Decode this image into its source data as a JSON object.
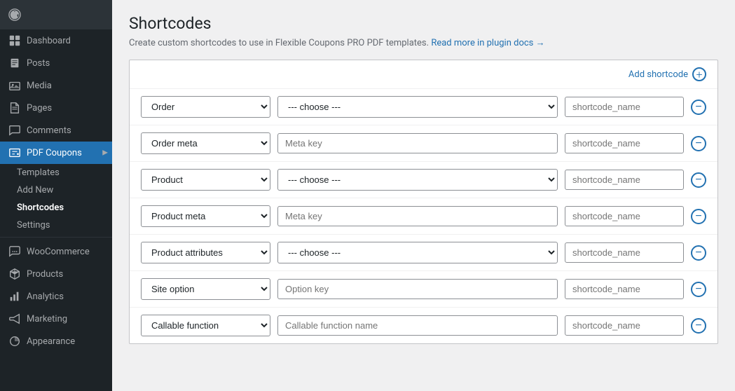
{
  "sidebar": {
    "logo_icon": "wp-logo",
    "items": [
      {
        "id": "dashboard",
        "label": "Dashboard",
        "icon": "dashboard"
      },
      {
        "id": "posts",
        "label": "Posts",
        "icon": "posts"
      },
      {
        "id": "media",
        "label": "Media",
        "icon": "media"
      },
      {
        "id": "pages",
        "label": "Pages",
        "icon": "pages"
      },
      {
        "id": "comments",
        "label": "Comments",
        "icon": "comments"
      },
      {
        "id": "pdf-coupons",
        "label": "PDF Coupons",
        "icon": "pdf-coupons",
        "active": true,
        "hasArrow": true
      }
    ],
    "pdf_coupons_subitems": [
      {
        "id": "templates",
        "label": "Templates"
      },
      {
        "id": "add-new",
        "label": "Add New"
      },
      {
        "id": "shortcodes",
        "label": "Shortcodes",
        "active": true
      },
      {
        "id": "settings",
        "label": "Settings"
      }
    ],
    "bottom_items": [
      {
        "id": "woocommerce",
        "label": "WooCommerce",
        "icon": "woocommerce"
      },
      {
        "id": "products",
        "label": "Products",
        "icon": "products"
      },
      {
        "id": "analytics",
        "label": "Analytics",
        "icon": "analytics"
      },
      {
        "id": "marketing",
        "label": "Marketing",
        "icon": "marketing"
      },
      {
        "id": "appearance",
        "label": "Appearance",
        "icon": "appearance"
      }
    ]
  },
  "page": {
    "title": "Shortcodes",
    "subtitle": "Create custom shortcodes to use in Flexible Coupons PRO PDF templates.",
    "docs_link": "Read more in plugin docs →"
  },
  "add_shortcode": {
    "label": "Add shortcode +"
  },
  "shortcode_rows": [
    {
      "id": "row1",
      "type_value": "Order",
      "type_options": [
        "Order",
        "Order meta",
        "Product",
        "Product meta",
        "Product attributes",
        "Site option",
        "Callable function"
      ],
      "field_type": "select",
      "field_value": "--- choose ---",
      "field_options": [
        "--- choose ---"
      ],
      "name_placeholder": "shortcode_name"
    },
    {
      "id": "row2",
      "type_value": "Order meta",
      "type_options": [
        "Order",
        "Order meta",
        "Product",
        "Product meta",
        "Product attributes",
        "Site option",
        "Callable function"
      ],
      "field_type": "text",
      "field_placeholder": "Meta key",
      "name_placeholder": "shortcode_name"
    },
    {
      "id": "row3",
      "type_value": "Product",
      "type_options": [
        "Order",
        "Order meta",
        "Product",
        "Product meta",
        "Product attributes",
        "Site option",
        "Callable function"
      ],
      "field_type": "select",
      "field_value": "--- choose ---",
      "field_options": [
        "--- choose ---"
      ],
      "name_placeholder": "shortcode_name"
    },
    {
      "id": "row4",
      "type_value": "Product meta",
      "type_options": [
        "Order",
        "Order meta",
        "Product",
        "Product meta",
        "Product attributes",
        "Site option",
        "Callable function"
      ],
      "field_type": "text",
      "field_placeholder": "Meta key",
      "name_placeholder": "shortcode_name"
    },
    {
      "id": "row5",
      "type_value": "Product attributes",
      "type_options": [
        "Order",
        "Order meta",
        "Product",
        "Product meta",
        "Product attributes",
        "Site option",
        "Callable function"
      ],
      "field_type": "select",
      "field_value": "--- choose ---",
      "field_options": [
        "--- choose ---"
      ],
      "name_placeholder": "shortcode_name"
    },
    {
      "id": "row6",
      "type_value": "Site option",
      "type_options": [
        "Order",
        "Order meta",
        "Product",
        "Product meta",
        "Product attributes",
        "Site option",
        "Callable function"
      ],
      "field_type": "text",
      "field_placeholder": "Option key",
      "name_placeholder": "shortcode_name"
    },
    {
      "id": "row7",
      "type_value": "Callable function",
      "type_options": [
        "Order",
        "Order meta",
        "Product",
        "Product meta",
        "Product attributes",
        "Site option",
        "Callable function"
      ],
      "field_type": "text",
      "field_placeholder": "Callable function name",
      "name_placeholder": "shortcode_name"
    }
  ]
}
